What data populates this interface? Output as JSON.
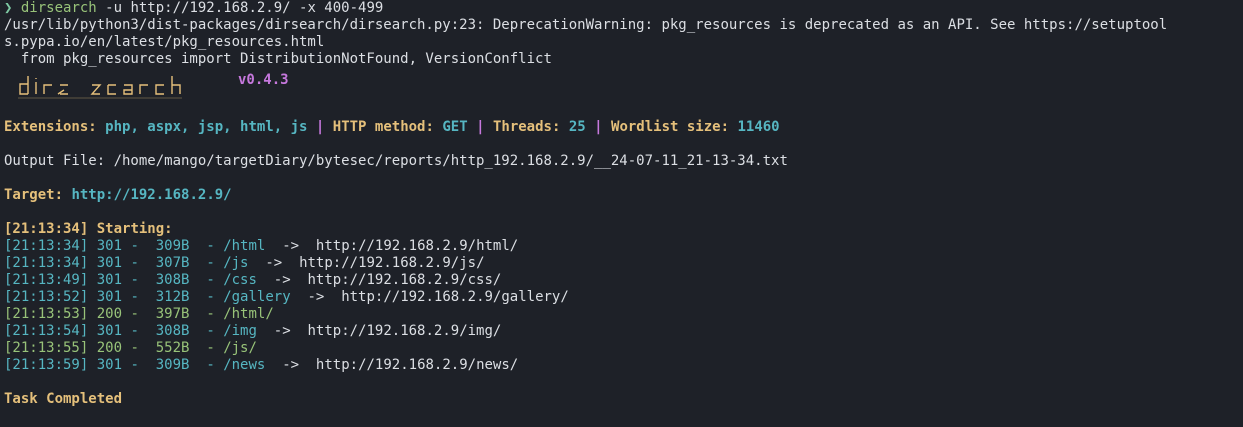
{
  "terminal": {
    "prompt": {
      "arrow": "❯",
      "command": "dirsearch",
      "args": " -u http://192.168.2.9/ -x 400-499"
    },
    "warning_lines": [
      "/usr/lib/python3/dist-packages/dirsearch/dirsearch.py:23: DeprecationWarning: pkg_resources is deprecated as an API. See https://setuptool",
      "s.pypa.io/en/latest/pkg_resources.html",
      "  from pkg_resources import DistributionNotFound, VersionConflict"
    ],
    "banner": {
      "version": "v0.4.3"
    },
    "config": {
      "ext_label": "Extensions:",
      "ext_value": "php, aspx, jsp, html, js",
      "sep": "|",
      "method_label": "HTTP method:",
      "method_value": "GET",
      "threads_label": "Threads:",
      "threads_value": "25",
      "wordlist_label": "Wordlist size:",
      "wordlist_value": "11460"
    },
    "output_file": "Output File: /home/mango/targetDiary/bytesec/reports/http_192.168.2.9/__24-07-11_21-13-34.txt",
    "target": {
      "label": "Target:",
      "value": "http://192.168.2.9/"
    },
    "starting": {
      "time": "[21:13:34]",
      "label": "Starting:"
    },
    "results": [
      {
        "time": "[21:13:34]",
        "status": "301",
        "size": "309B",
        "path": "/html",
        "arrow": "->",
        "redirect": "http://192.168.2.9/html/",
        "color": "#56b6c2"
      },
      {
        "time": "[21:13:34]",
        "status": "301",
        "size": "307B",
        "path": "/js",
        "arrow": "->",
        "redirect": "http://192.168.2.9/js/",
        "color": "#56b6c2"
      },
      {
        "time": "[21:13:49]",
        "status": "301",
        "size": "308B",
        "path": "/css",
        "arrow": "->",
        "redirect": "http://192.168.2.9/css/",
        "color": "#56b6c2"
      },
      {
        "time": "[21:13:52]",
        "status": "301",
        "size": "312B",
        "path": "/gallery",
        "arrow": "->",
        "redirect": "http://192.168.2.9/gallery/",
        "color": "#56b6c2"
      },
      {
        "time": "[21:13:53]",
        "status": "200",
        "size": "397B",
        "path": "/html/",
        "arrow": "",
        "redirect": "",
        "color": "#98c379"
      },
      {
        "time": "[21:13:54]",
        "status": "301",
        "size": "308B",
        "path": "/img",
        "arrow": "->",
        "redirect": "http://192.168.2.9/img/",
        "color": "#56b6c2"
      },
      {
        "time": "[21:13:55]",
        "status": "200",
        "size": "552B",
        "path": "/js/",
        "arrow": "",
        "redirect": "",
        "color": "#98c379"
      },
      {
        "time": "[21:13:59]",
        "status": "301",
        "size": "309B",
        "path": "/news",
        "arrow": "->",
        "redirect": "http://192.168.2.9/news/",
        "color": "#56b6c2"
      }
    ],
    "task_completed": "Task Completed"
  },
  "colors": {
    "background": "#1e2128",
    "foreground": "#dcdfe4",
    "yellow": "#e5c07b",
    "cyan": "#56b6c2",
    "green": "#98c379",
    "magenta": "#c678dd"
  }
}
